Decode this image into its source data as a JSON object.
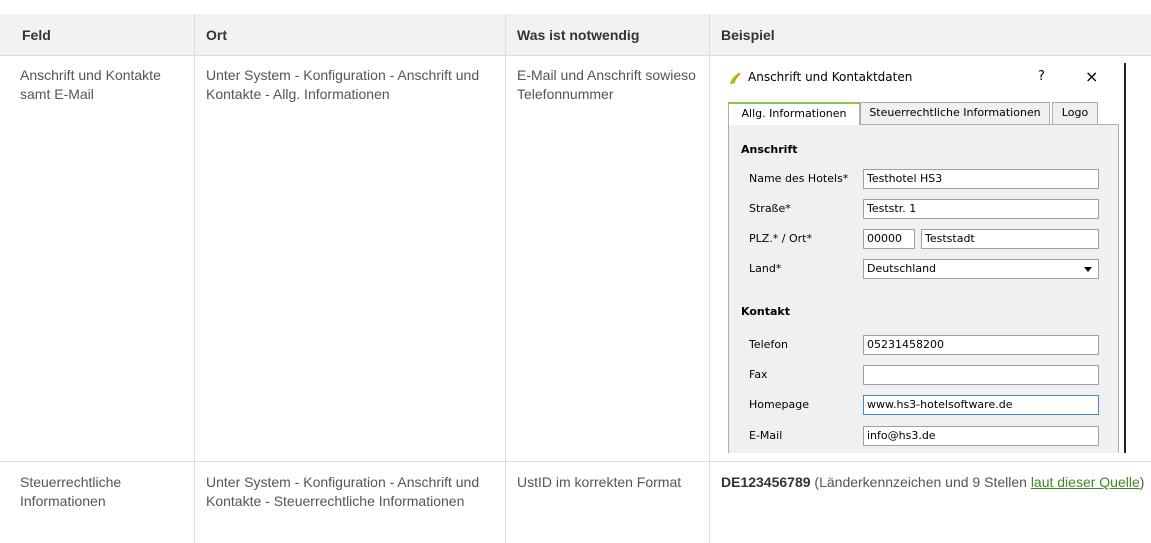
{
  "header": {
    "col1": "Feld",
    "col2": "Ort",
    "col3": "Was ist notwendig",
    "col4": "Beispiel"
  },
  "rows": [
    {
      "feld": "Anschrift und Kontakte samt E-Mail",
      "ort": "Unter System - Konfiguration - Anschrift und Kontakte - Allg. Informationen",
      "notwendig": "E-Mail und Anschrift sowieso Telefonnummer"
    },
    {
      "feld": "Steuerrechtliche Informationen",
      "ort": "Unter System - Konfiguration - Anschrift und Kontakte - Steuerrechtliche Informationen",
      "notwendig": "UstID im korrekten Format",
      "beispiel_bold": "DE123456789",
      "beispiel_text": " (Länderkennzeichen und 9 Stellen ",
      "beispiel_link": "laut dieser Quelle",
      "beispiel_end": ")"
    }
  ],
  "dialog": {
    "title": "Anschrift und Kontaktdaten",
    "help": "?",
    "close": "×",
    "tabs": [
      "Allg. Informationen",
      "Steuerrechtliche Informationen",
      "Logo"
    ],
    "section_anschrift": "Anschrift",
    "section_kontakt": "Kontakt",
    "fields": {
      "hotel_label": "Name des Hotels*",
      "hotel_value": "Testhotel HS3",
      "strasse_label": "Straße*",
      "strasse_value": "Teststr. 1",
      "plz_label": "PLZ.* / Ort*",
      "plz_value": "00000",
      "ort_value": "Teststadt",
      "land_label": "Land*",
      "land_value": "Deutschland",
      "telefon_label": "Telefon",
      "telefon_value": "05231458200",
      "fax_label": "Fax",
      "fax_value": "",
      "homepage_label": "Homepage",
      "homepage_value": "www.hs3-hotelsoftware.de",
      "email_label": "E-Mail",
      "email_value": "info@hs3.de"
    }
  },
  "colors": {
    "header_bg": "#f2f2f2",
    "border": "#dddddd",
    "link": "#3a8a1f",
    "tab_accent": "#8cc63f"
  }
}
